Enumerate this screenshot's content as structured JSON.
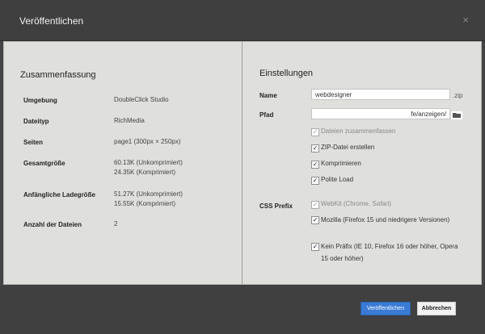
{
  "dialog": {
    "title": "Veröffentlichen",
    "close_glyph": "×"
  },
  "summary": {
    "title": "Zusammenfassung",
    "rows": [
      {
        "label": "Umgebung",
        "value": "DoubleClick Studio"
      },
      {
        "label": "Dateityp",
        "value": "RichMedia"
      },
      {
        "label": "Seiten",
        "value": "page1 (300px × 250px)"
      },
      {
        "label": "Gesamtgröße",
        "value1": "60.13K (Unkomprimiert)",
        "value2": "24.35K (Komprimiert)"
      },
      {
        "label": "Anfängliche Ladegröße",
        "value1": "51.27K (Unkomprimiert)",
        "value2": "15.55K (Komprimiert)"
      },
      {
        "label": "Anzahl der Dateien",
        "value": "2"
      }
    ]
  },
  "settings": {
    "title": "Einstellungen",
    "name_label": "Name",
    "name_value": "webdesigner",
    "name_suffix": ".zip",
    "path_label": "Pfad",
    "path_value": "fe/anzeigen/",
    "options": [
      {
        "label": "Dateien zusammenfassen",
        "checked": true,
        "disabled": true
      },
      {
        "label": "ZIP-Datei erstellen",
        "checked": true,
        "disabled": false
      },
      {
        "label": "Komprimieren",
        "checked": true,
        "disabled": false
      },
      {
        "label": "Polite Load",
        "checked": true,
        "disabled": false
      }
    ],
    "css_prefix_label": "CSS Prefix",
    "css_options": [
      {
        "label": "WebKit (Chrome, Safari)",
        "checked": true,
        "disabled": true
      },
      {
        "label": "Mozilla (Firefox 15 und niedrigere Versionen)",
        "checked": true,
        "disabled": false
      },
      {
        "label": "Kein Präfix (IE 10, Firefox 16 oder höher, Opera 15 oder höher)",
        "checked": true,
        "disabled": false
      }
    ]
  },
  "buttons": {
    "publish": "Veröffentlichen",
    "cancel": "Abbrechen"
  },
  "colors": {
    "primary": "#3a7bd5",
    "panel": "#dfe0dc",
    "chrome": "#444444"
  },
  "icons": {
    "folder": "folder-icon",
    "close": "close-icon",
    "check": "check-icon"
  }
}
